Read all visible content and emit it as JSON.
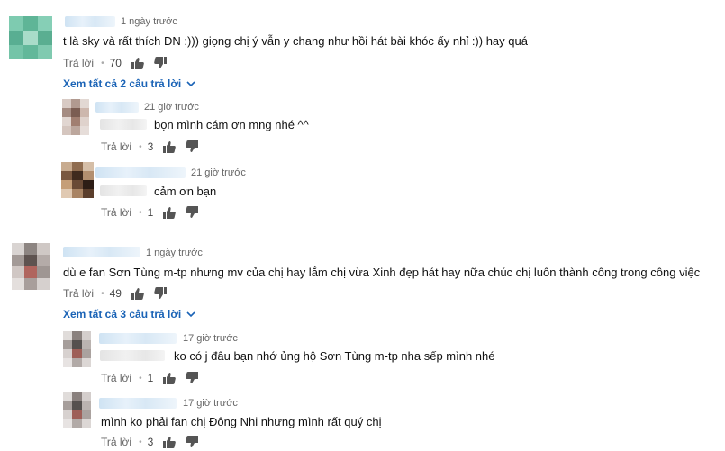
{
  "comments": [
    {
      "time": "1 ngày trước",
      "text": "t là sky và rất thích ĐN :))) giọng chị ý vẫn y chang như hồi hát bài khóc ấy nhỉ :)) hay quá",
      "reply_label": "Trả lời",
      "likes": "70",
      "view_replies": "Xem tất cả 2 câu trả lời",
      "replies": [
        {
          "time": "21 giờ trước",
          "text": "bọn mình cám ơn mng nhé ^^",
          "reply_label": "Trả lời",
          "likes": "3"
        },
        {
          "time": "21 giờ trước",
          "text": "cảm ơn bạn",
          "reply_label": "Trả lời",
          "likes": "1"
        }
      ]
    },
    {
      "time": "1 ngày trước",
      "text": "dù e fan Sơn Tùng m-tp nhưng mv của chị hay lắm chị vừa Xinh đẹp hát hay nữa  chúc chị luôn thành công trong công việc",
      "reply_label": "Trả lời",
      "likes": "49",
      "view_replies": "Xem tất cả 3 câu trả lời",
      "replies": [
        {
          "time": "17 giờ trước",
          "text": "ko có j đâu bạn nhớ ủng hộ Sơn Tùng m-tp nha sếp mình nhé",
          "reply_label": "Trả lời",
          "likes": "1"
        },
        {
          "time": "17 giờ trước",
          "text": "mình ko phải fan chị Đông Nhi nhưng mình rất quý chị",
          "reply_label": "Trả lời",
          "likes": "3"
        }
      ]
    }
  ],
  "icons": {
    "like": "thumb-up-icon",
    "dislike": "thumb-down-icon",
    "expand": "chevron-down-icon"
  },
  "colors": {
    "link": "#1a63b6",
    "meta": "#666666",
    "icon": "#555555"
  }
}
